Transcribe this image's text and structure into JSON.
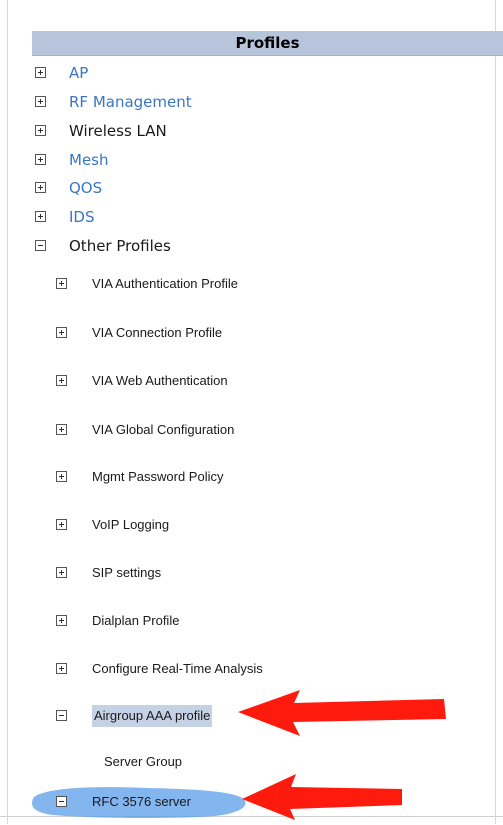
{
  "panel": {
    "title": "Profiles"
  },
  "tree": {
    "top_items": [
      {
        "label": "AP",
        "state": "collapsed",
        "color": "#3a76c4"
      },
      {
        "label": "RF Management",
        "state": "collapsed",
        "color": "#3a76c4"
      },
      {
        "label": "Wireless LAN",
        "state": "collapsed",
        "color": "#1a1a1a"
      },
      {
        "label": "Mesh",
        "state": "collapsed",
        "color": "#3a76c4"
      },
      {
        "label": "QOS",
        "state": "collapsed",
        "color": "#3a76c4"
      },
      {
        "label": "IDS",
        "state": "collapsed",
        "color": "#3a76c4"
      },
      {
        "label": "Other Profiles",
        "state": "expanded",
        "color": "#1a1a1a"
      }
    ],
    "other_profiles": [
      {
        "label": "VIA Authentication Profile",
        "state": "collapsed"
      },
      {
        "label": "VIA Connection Profile",
        "state": "collapsed"
      },
      {
        "label": "VIA Web Authentication",
        "state": "collapsed"
      },
      {
        "label": "VIA Global Configuration",
        "state": "collapsed"
      },
      {
        "label": "Mgmt Password Policy",
        "state": "collapsed"
      },
      {
        "label": "VoIP Logging",
        "state": "collapsed"
      },
      {
        "label": "SIP settings",
        "state": "collapsed"
      },
      {
        "label": "Dialplan Profile",
        "state": "collapsed"
      },
      {
        "label": "Configure Real-Time Analysis",
        "state": "collapsed"
      },
      {
        "label": "Airgroup AAA profile",
        "state": "expanded",
        "selected": true
      }
    ],
    "airgroup_children": [
      {
        "label": "Server Group"
      },
      {
        "label": "RFC 3576 server",
        "state": "expanded"
      }
    ]
  },
  "colors": {
    "header_bg": "#b7c5dc",
    "link": "#3a76c4",
    "selection": "#c5d2e6",
    "annotation_arrow": "#ff1a0e",
    "annotation_highlight": "#5a9ce8"
  },
  "annotations": {
    "icons": [
      "red-arrow-icon",
      "blue-highlight-scribble"
    ]
  }
}
